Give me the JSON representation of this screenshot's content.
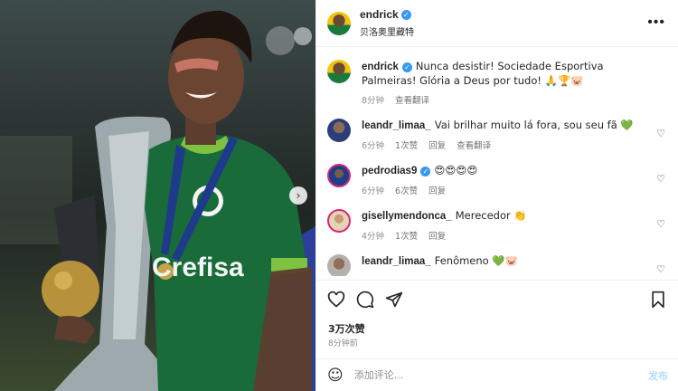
{
  "post": {
    "author": "endrick",
    "location": "贝洛奥里藏特",
    "caption": "Nunca desistir! Sociedade Esportiva Palmeiras! Glória a Deus por tudo! 🙏🏆🐷",
    "caption_time": "8分钟",
    "caption_translate": "查看翻译",
    "more_icon": "more-options-icon",
    "verified_icon": "verified-badge-icon",
    "photo_next_icon": "chevron-right-icon",
    "jersey_text": "Crefisa"
  },
  "comments": [
    {
      "user": "leandr_limaa_",
      "text": "Vai brilhar muito lá fora, sou seu fã 💚",
      "time": "6分钟",
      "likes": "1次赞",
      "reply": "回复",
      "translate": "查看翻译",
      "verified": false
    },
    {
      "user": "pedrodias9",
      "text": "😍😍😍😍",
      "time": "6分钟",
      "likes": "6次赞",
      "reply": "回复",
      "verified": true
    },
    {
      "user": "gisellymendonca_",
      "text": "Merecedor 👏",
      "time": "4分钟",
      "likes": "1次赞",
      "reply": "回复",
      "verified": false
    },
    {
      "user": "leandr_limaa_",
      "text": "Fenômeno 💚🐷",
      "time": "",
      "likes": "",
      "reply": "",
      "verified": false
    }
  ],
  "actions": {
    "like_icon": "heart-icon",
    "comment_icon": "comment-icon",
    "share_icon": "share-icon",
    "save_icon": "bookmark-icon",
    "likes_count": "3万次赞",
    "time_ago": "8分钟前"
  },
  "composer": {
    "emoji_icon": "emoji-icon",
    "placeholder": "添加评论...",
    "post_label": "发布"
  },
  "colors": {
    "accent": "#3897f0",
    "post_disabled": "#b2dffc",
    "muted": "#8e8e8e",
    "jersey_green": "#1a6b3a"
  }
}
